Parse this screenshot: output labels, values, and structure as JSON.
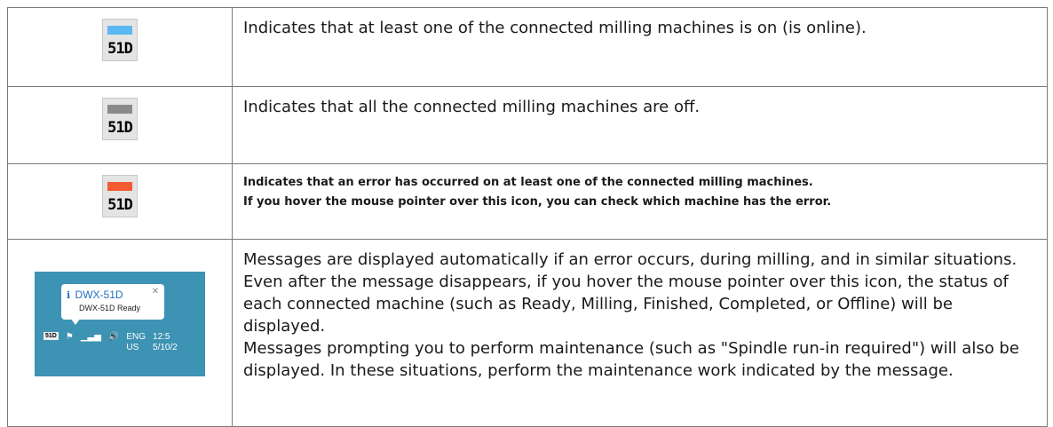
{
  "rows": [
    {
      "icon": {
        "name": "online-status-icon",
        "label": "51D",
        "bar_color": "#5cb8f2"
      },
      "text": "Indicates that at least one of the connected milling machines is on (is online)."
    },
    {
      "icon": {
        "name": "offline-status-icon",
        "label": "51D",
        "bar_color": "#8a8a8a"
      },
      "text": "Indicates that all the connected milling machines are off."
    },
    {
      "icon": {
        "name": "error-status-icon",
        "label": "51D",
        "bar_color": "#f35b30"
      },
      "text_lines": [
        "Indicates that an error has occurred on at least one of the connected milling machines.",
        "If you hover the mouse pointer over this icon, you can check which machine has the error."
      ]
    }
  ],
  "tray": {
    "popup_title": "DWX-51D",
    "popup_status": "DWX-51D Ready",
    "mini_icon_label": "51D",
    "lang": "ENG",
    "region": "US",
    "time": "12:5",
    "date": "5/10/2",
    "tray_bg": "#3d93b3"
  },
  "message_text": {
    "para1": "Messages are displayed automatically if an error occurs, during milling, and in similar situations. Even after the message disappears, if you hover the mouse pointer over this icon, the status of each connected machine (such as Ready, Milling, Finished, Completed, or Offline) will be displayed.",
    "para2": "Messages prompting you to perform maintenance (such as \"Spindle run-in required\") will also be displayed. In these situations, perform the maintenance work indicated by the message."
  }
}
